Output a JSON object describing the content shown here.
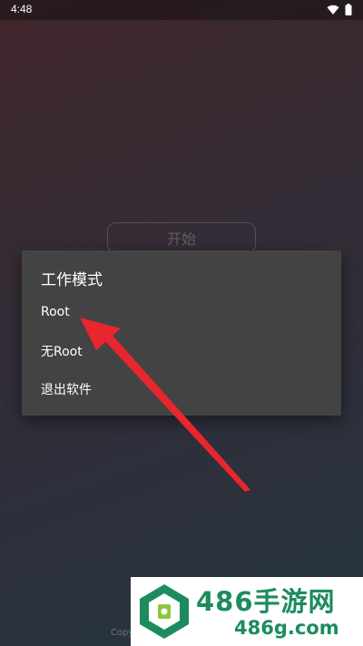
{
  "status_bar": {
    "time": "4:48"
  },
  "main": {
    "start_label": "开始",
    "copyright": "Copy"
  },
  "dialog": {
    "title": "工作模式",
    "items": [
      {
        "label": "Root"
      },
      {
        "label": "无Root"
      },
      {
        "label": "退出软件"
      }
    ]
  },
  "watermark": {
    "title": "486手游网",
    "subtitle": "486g.com"
  },
  "colors": {
    "dialog_bg": "#434343",
    "arrow": "#e8262d",
    "brand_green": "#1c8c5e"
  }
}
